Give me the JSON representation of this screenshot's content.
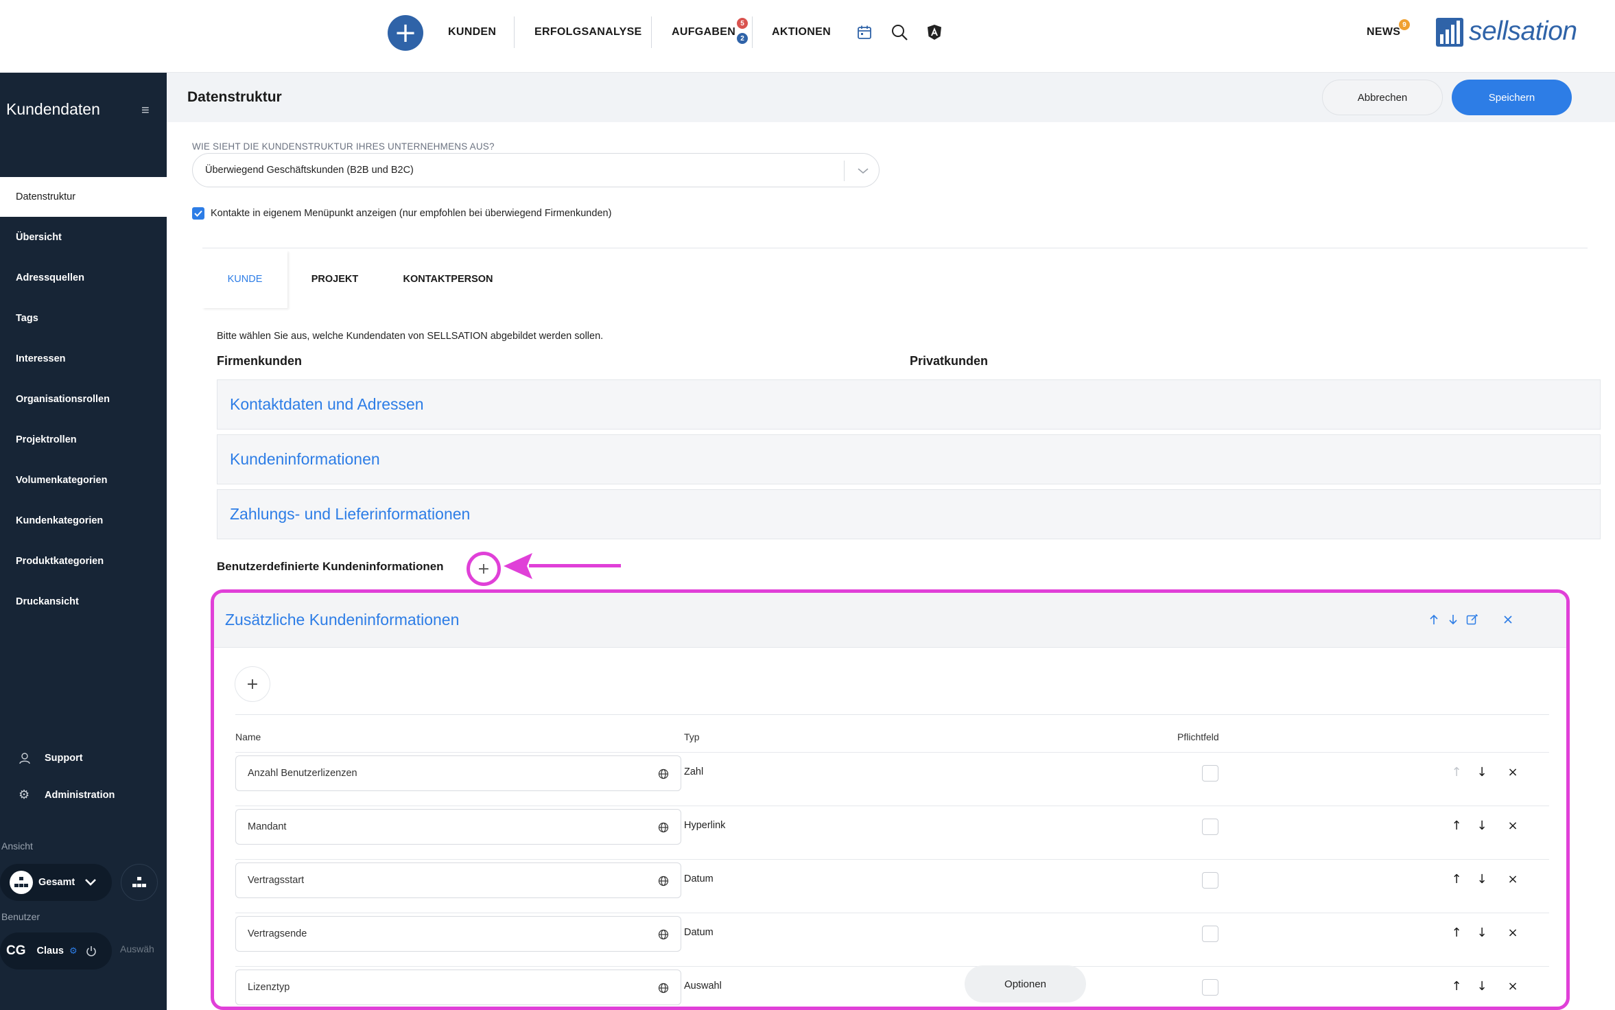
{
  "topnav": {
    "items": [
      "KUNDEN",
      "ERFOLGSANALYSE",
      "AUFGABEN",
      "AKTIONEN"
    ],
    "aufgaben_badges": [
      "5",
      "2"
    ],
    "news_label": "NEWS",
    "news_badge": "9",
    "brand": "sellsation",
    "colors": {
      "primary": "#2f63a8",
      "badge_red": "#d9534f",
      "badge_blue": "#2f63a8",
      "badge_orange": "#f0a030"
    }
  },
  "sidebar": {
    "title": "Kundendaten",
    "items": [
      "Datenstruktur",
      "Übersicht",
      "Adressquellen",
      "Tags",
      "Interessen",
      "Organisationsrollen",
      "Projektrollen",
      "Volumenkategorien",
      "Kundenkategorien",
      "Produktkategorien",
      "Druckansicht"
    ],
    "active_index": 0,
    "support": "Support",
    "administration": "Administration",
    "ansicht_label": "Ansicht",
    "ansicht_value": "Gesamt",
    "benutzer_label": "Benutzer",
    "user_initials": "CG",
    "user_name": "Claus",
    "select_placeholder": "Auswäh"
  },
  "header": {
    "title": "Datenstruktur",
    "cancel": "Abbrechen",
    "save": "Speichern"
  },
  "structure": {
    "question": "WIE SIEHT DIE KUNDENSTRUKTUR IHRES UNTERNEHMENS AUS?",
    "selected": "Überwiegend Geschäftskunden (B2B und B2C)",
    "checkbox_label": "Kontakte in eigenem Menüpunkt anzeigen (nur empfohlen bei überwiegend Firmenkunden)",
    "checkbox_checked": true
  },
  "tabs": [
    "KUNDE",
    "PROJEKT",
    "KONTAKTPERSON"
  ],
  "active_tab": 0,
  "content": {
    "intro": "Bitte wählen Sie aus, welche Kundendaten von SELLSATION abgebildet werden sollen.",
    "col_company": "Firmenkunden",
    "col_private": "Privatkunden",
    "sections": [
      "Kontaktdaten und Adressen",
      "Kundeninformationen",
      "Zahlungs- und Lieferinformationen"
    ],
    "custom_label": "Benutzerdefinierte Kundeninformationen"
  },
  "panel": {
    "title": "Zusätzliche Kundeninformationen",
    "headers": {
      "name": "Name",
      "type": "Typ",
      "required": "Pflichtfeld"
    },
    "rows": [
      {
        "name": "Anzahl Benutzerlizenzen",
        "type": "Zahl"
      },
      {
        "name": "Mandant",
        "type": "Hyperlink"
      },
      {
        "name": "Vertragsstart",
        "type": "Datum"
      },
      {
        "name": "Vertragsende",
        "type": "Datum"
      },
      {
        "name": "Lizenztyp",
        "type": "Auswahl",
        "options": "Optionen"
      }
    ]
  },
  "highlight_color": "#e040d8"
}
